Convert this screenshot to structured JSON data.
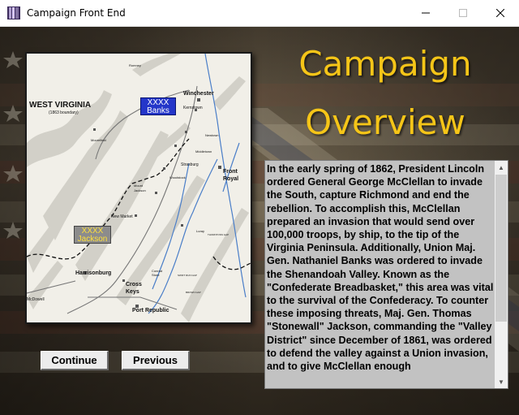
{
  "window": {
    "title": "Campaign Front End",
    "minimize_glyph": "—",
    "maximize_glyph": "☐",
    "close_glyph": "✕"
  },
  "heading": {
    "line1": "Campaign",
    "line2": "Overview"
  },
  "map": {
    "state_label": "WEST VIRGINIA",
    "boundary_note": "(1863 boundary)",
    "banks_unit": {
      "size": "XXXX",
      "name": "Banks"
    },
    "jackson_unit": {
      "size": "XXXX",
      "name": "Jackson"
    },
    "places": {
      "winchester": "Winchester",
      "front_royal_1": "Front",
      "front_royal_2": "Royal",
      "harrisonburg": "Harrisonburg",
      "cross_keys_1": "Cross",
      "cross_keys_2": "Keys",
      "port_republic": "Port Republic",
      "mcdowell": "McDowell",
      "new_market": "New Market",
      "strasburg": "Strasburg",
      "romney": "Romney",
      "kernstown": "Kernstown",
      "middletown": "Middletown",
      "newtown": "Newtown",
      "woodstock": "Woodstock",
      "luray": "Luray",
      "moorefield": "Moorefield",
      "mount_jackson_1": "Mount",
      "mount_jackson_2": "Jackson",
      "conrad_store_1": "Conrad",
      "conrad_store_2": "Store",
      "swift_run_gap": "SWIFT RUN GAP",
      "thorntons_gap": "THORNTONS GAP",
      "brown_gap": "BROWN GAP"
    }
  },
  "overview_text": "In the early spring of 1862, President Lincoln ordered General George McClellan to invade the South, capture Richmond and end the rebellion.  To accomplish this, McClellan prepared an invasion that would send over 100,000 troops, by ship, to the tip of the Virginia Peninsula.  Additionally, Union Maj. Gen. Nathaniel Banks was ordered to invade the Shenandoah Valley.  Known as the \"Confederate Breadbasket,\" this area was vital to the survival of the Confederacy.  To counter these imposing threats, Maj. Gen. Thomas \"Stonewall\" Jackson, commanding the \"Valley District\" since December of 1861, was ordered to defend the valley against a Union invasion, and to give McClellan enough",
  "scroll": {
    "up_glyph": "▲",
    "down_glyph": "▼",
    "position_fraction": 0.0
  },
  "buttons": {
    "continue": "Continue",
    "previous": "Previous"
  },
  "colors": {
    "heading": "#f5c518",
    "banks": "#2436c9",
    "jackson_text": "#ffe03a",
    "panel": "#c2c2c2"
  }
}
